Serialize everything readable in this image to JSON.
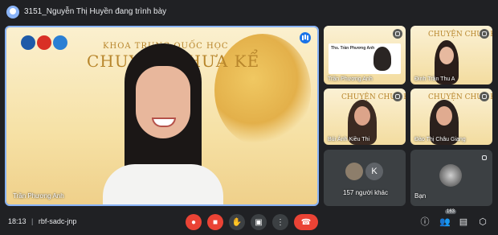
{
  "topbar": {
    "presenting_text": "3151_Nguyễn Thị Huyền đang trình bày"
  },
  "main_tile": {
    "slide_line1": "KHOA TRUNG QUỐC HỌC",
    "slide_line2": "CHUYỆN CHƯA KỂ",
    "participant_name": "Trần Phương Anh"
  },
  "tiles": [
    {
      "label": "Trần Phương Anh",
      "card_title": "Ths. Trần Phương Anh"
    },
    {
      "label": "Đinh Trần Thu A",
      "slide_title": "CHUYỆN CHƯA KỂ"
    },
    {
      "label": "Bùi Ánh Kiều Thi",
      "slide_title": "CHUYỆN CHƯA KỂ"
    },
    {
      "label": "Đào Thị Châu Giang",
      "slide_title": "CHUYỆN CHƯA KỂ"
    },
    {
      "label": "157 người khác",
      "avatar_letter": "K"
    },
    {
      "label": "Bạn"
    }
  ],
  "bottombar": {
    "time": "18:13",
    "meeting_code": "rbf-sadc-jnp",
    "participants_count": "163",
    "accent_red": "#ea4335",
    "accent_blue": "#8ab4f8"
  }
}
